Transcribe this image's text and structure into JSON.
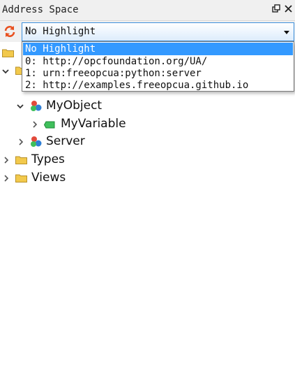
{
  "window": {
    "title": "Address Space",
    "controls": [
      "float-icon",
      "close-icon"
    ]
  },
  "toolbar": {
    "refresh_icon": "refresh-icon",
    "accent": "#e8501f"
  },
  "combo": {
    "selected": "No Highlight",
    "options": [
      "No Highlight",
      "0: http://opcfoundation.org/UA/",
      "1: urn:freeopcua:python:server",
      "2: http://examples.freeopcua.github.io"
    ]
  },
  "tree": {
    "nodes": [
      {
        "label": "MyObject",
        "icon": "object-icon",
        "expanded": true
      },
      {
        "label": "MyVariable",
        "icon": "variable-icon",
        "expanded": false
      },
      {
        "label": "Server",
        "icon": "object-icon",
        "expanded": false
      },
      {
        "label": "Types",
        "icon": "folder-icon",
        "expanded": false
      },
      {
        "label": "Views",
        "icon": "folder-icon",
        "expanded": false
      }
    ]
  },
  "colors": {
    "selection": "#3399ff",
    "combo_border": "#3c8fdb",
    "folder": "#f2c94c",
    "variable": "#3fbf5b"
  }
}
